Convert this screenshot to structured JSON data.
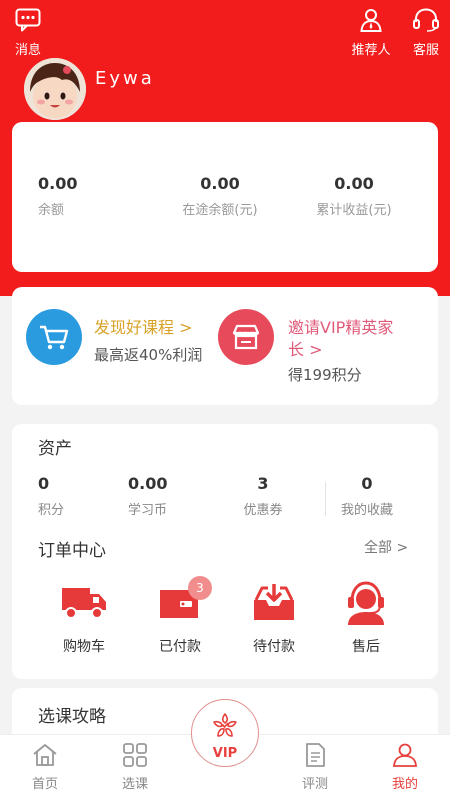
{
  "header": {
    "messages_label": "消息",
    "referrer_label": "推荐人",
    "service_label": "客服"
  },
  "user": {
    "name": "Eywa"
  },
  "balance": [
    {
      "value": "0.00",
      "label": "余额"
    },
    {
      "value": "0.00",
      "label": "在途余额(元)"
    },
    {
      "value": "0.00",
      "label": "累计收益(元)"
    }
  ],
  "promos": [
    {
      "title": "发现好课程 >",
      "subtitle": "最高返40%利润",
      "icon": "cart-icon",
      "color": "#2a9bdf",
      "title_color": "#d9a227"
    },
    {
      "title": "邀请VIP精英家长 >",
      "title_line1": "邀请VIP精英家",
      "title_line2": "长 >",
      "subtitle": "得199积分",
      "icon": "store-icon",
      "color": "#e74b5b",
      "title_color": "#e05a7a"
    }
  ],
  "assets": {
    "title": "资产",
    "items": [
      {
        "value": "0",
        "label": "积分"
      },
      {
        "value": "0.00",
        "label": "学习币"
      },
      {
        "value": "3",
        "label": "优惠券"
      },
      {
        "value": "0",
        "label": "我的收藏"
      }
    ]
  },
  "orders": {
    "title": "订单中心",
    "all_label": "全部 >",
    "items": [
      {
        "label": "购物车",
        "icon": "truck-icon"
      },
      {
        "label": "已付款",
        "icon": "card-icon",
        "badge": "3"
      },
      {
        "label": "待付款",
        "icon": "inbox-download-icon"
      },
      {
        "label": "售后",
        "icon": "headset-agent-icon"
      }
    ]
  },
  "guide": {
    "title": "选课攻略"
  },
  "nav": {
    "items": [
      {
        "label": "首页",
        "icon": "home-icon"
      },
      {
        "label": "选课",
        "icon": "grid-icon"
      },
      {
        "label": "VIP",
        "icon": "vip-flower-icon"
      },
      {
        "label": "评测",
        "icon": "document-icon"
      },
      {
        "label": "我的",
        "icon": "person-icon",
        "active": true
      }
    ]
  },
  "colors": {
    "brand_red": "#f21c1c",
    "accent_red": "#e8403c",
    "cart_blue": "#2a9bdf",
    "gold": "#d9a227"
  }
}
